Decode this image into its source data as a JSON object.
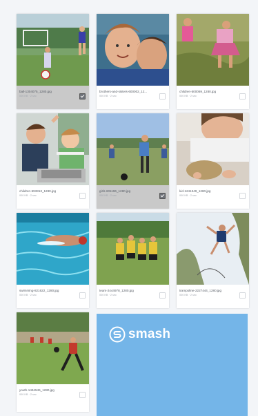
{
  "gallery": {
    "items": [
      {
        "file": "ball-1304075_1280.jpg",
        "meta": "000 KB · 2 sec",
        "selected": true,
        "scene": "soccer-ball-field"
      },
      {
        "file": "brothers-and-sisters-600002_12...",
        "meta": "000 KB · 2 sec",
        "selected": false,
        "scene": "two-boys"
      },
      {
        "file": "children-500069_1280.jpg",
        "meta": "000 KB · 2 sec",
        "selected": false,
        "scene": "kids-grass"
      },
      {
        "file": "children-593313_1280.jpg",
        "meta": "000 KB · 2 sec",
        "selected": false,
        "scene": "kids-laptop"
      },
      {
        "file": "girls-601196_1280.jpg",
        "meta": "000 KB · 2 sec",
        "selected": true,
        "scene": "girls-soccer"
      },
      {
        "file": "kid-1241349_1280.jpg",
        "meta": "000 KB · 2 sec",
        "selected": false,
        "scene": "kid-closeup"
      },
      {
        "file": "swimming-821622_1280.jpg",
        "meta": "000 KB · 2 sec",
        "selected": false,
        "scene": "swimming"
      },
      {
        "file": "team-2444978_1280.jpg",
        "meta": "000 KB · 2 sec",
        "selected": false,
        "scene": "yellow-team"
      },
      {
        "file": "trampoline-2227444_1280.jpg",
        "meta": "000 KB · 2 sec",
        "selected": false,
        "scene": "trampoline"
      },
      {
        "file": "youth-1434545_1280.jpg",
        "meta": "000 KB · 2 sec",
        "selected": false,
        "scene": "youth-soccer"
      }
    ]
  },
  "promo": {
    "brand": "smash",
    "icon": "smash-logo-icon",
    "color": "#74b5e8"
  }
}
